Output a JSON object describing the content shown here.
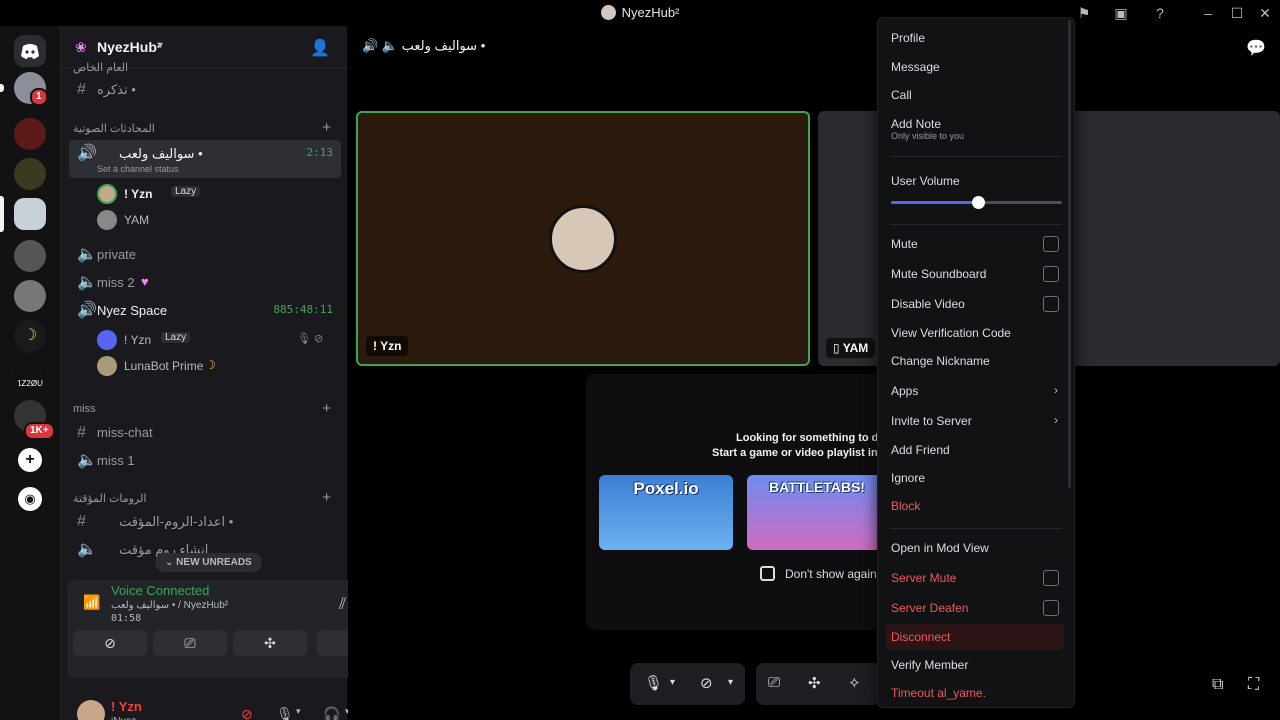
{
  "window": {
    "title": "NyezHub²"
  },
  "server_rail": {
    "mention_badge": "1",
    "count_badge": "1K+",
    "server_label": "1Z2ØU"
  },
  "guild": {
    "name": "NyezHub²"
  },
  "channels": {
    "top_category": "العام الخاص",
    "text_channel_1": "تذكره •",
    "voice_category": "المحادثات الصوتية",
    "active_voice": {
      "name": "سواليف ولعب •",
      "time": "2:13",
      "status": "Set a channel status"
    },
    "active_members": [
      {
        "name": "! Yzn",
        "tag": "Lazy"
      },
      {
        "name": "YAM"
      }
    ],
    "voice_private": "private",
    "voice_miss2": "miss 2",
    "voice_nyez": {
      "name": "Nyez Space",
      "time": "885:48:11"
    },
    "nyez_members": [
      {
        "name": "! Yzn",
        "tag": "Lazy"
      },
      {
        "name": "LunaBot Prime"
      }
    ],
    "miss_category": "miss",
    "miss_chat": "miss-chat",
    "miss_1": "miss 1",
    "temp_category": "الرومات المؤقتة",
    "temp_settings": "اعداد-الروم-المؤقت •",
    "temp_create": "انشاء روم مؤقت",
    "new_unreads": "NEW UNREADS"
  },
  "voice_panel": {
    "status": "Voice Connected",
    "location": "سواليف ولعب • / NyezHub²",
    "timer": "01:58"
  },
  "user_panel": {
    "name": "! Yzn",
    "status": "iNyez"
  },
  "stage": {
    "header": "سواليف ولعب •",
    "tile1_name": "! Yzn",
    "tile2_name": "YAM",
    "activity_line1": "Looking for something to d",
    "activity_line2": "Start a game or video playlist in",
    "game1": "Poxel.io",
    "game2": "BATTLETABS!",
    "dont_show": "Don't show again"
  },
  "menu": {
    "profile": "Profile",
    "message": "Message",
    "call": "Call",
    "add_note": "Add Note",
    "add_note_sub": "Only visible to you",
    "user_volume": "User Volume",
    "user_volume_value": 0.51,
    "mute": "Mute",
    "mute_soundboard": "Mute Soundboard",
    "disable_video": "Disable Video",
    "view_verification": "View Verification Code",
    "change_nickname": "Change Nickname",
    "apps": "Apps",
    "invite": "Invite to Server",
    "add_friend": "Add Friend",
    "ignore": "Ignore",
    "block": "Block",
    "mod_view": "Open in Mod View",
    "server_mute": "Server Mute",
    "server_deafen": "Server Deafen",
    "disconnect": "Disconnect",
    "verify": "Verify Member",
    "timeout": "Timeout al_yame."
  },
  "colors": {
    "accent": "#5865f2",
    "connected_green": "#3ba55d",
    "danger_red": "#f0575b"
  }
}
